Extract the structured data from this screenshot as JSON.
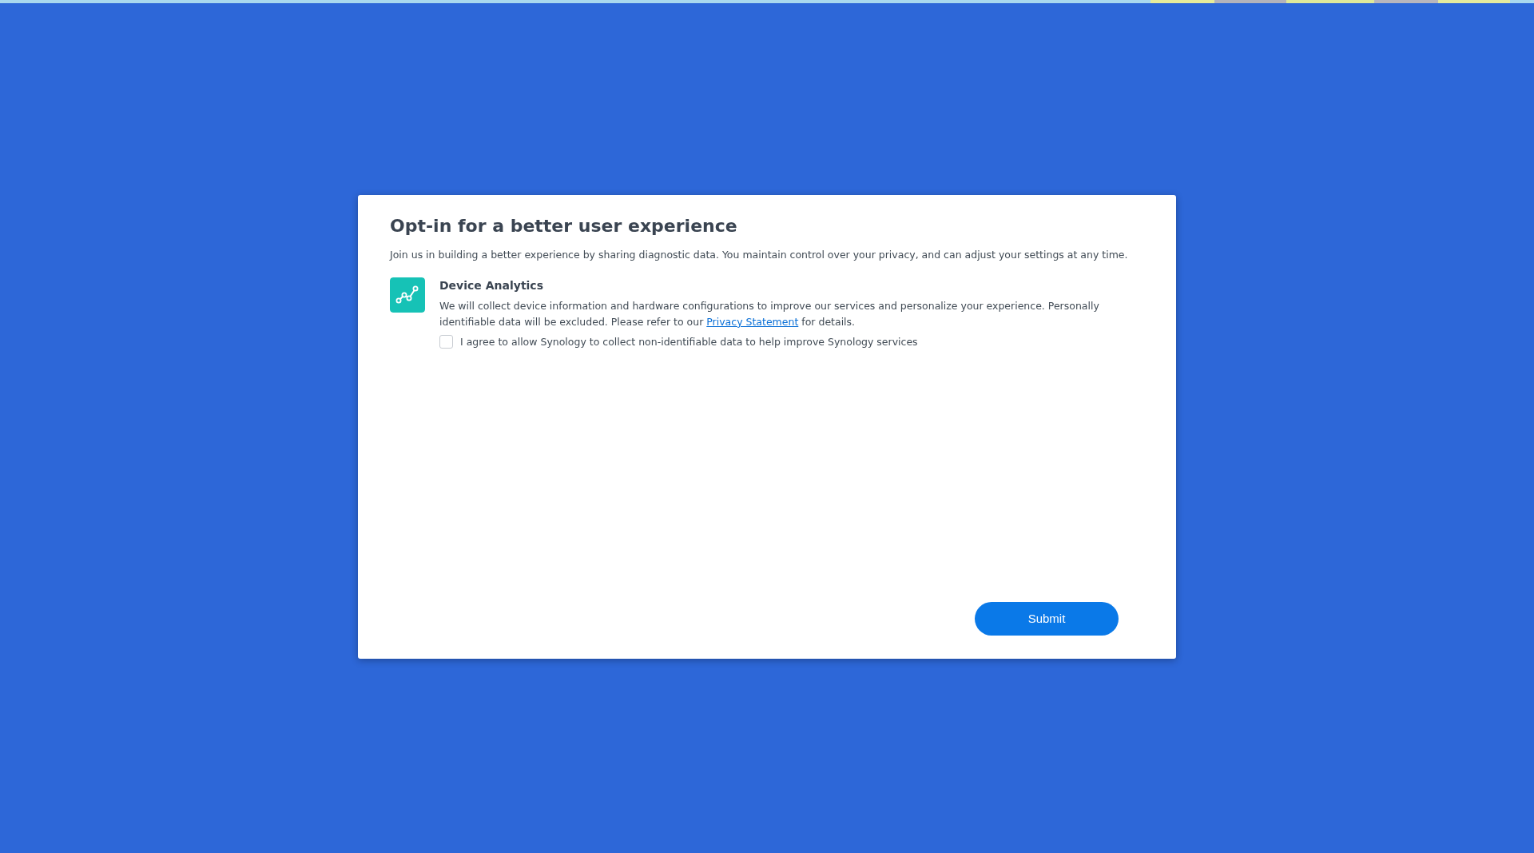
{
  "dialog": {
    "title": "Opt-in for a better user experience",
    "intro": "Join us in building a better experience by sharing diagnostic data. You maintain control over your privacy, and can adjust your settings at any time.",
    "section": {
      "title": "Device Analytics",
      "text_before": "We will collect device information and hardware configurations to improve our services and personalize your experience. Personally identifiable data will be excluded. Please refer to our",
      "link": "Privacy Statement",
      "text_after": "for details."
    },
    "consent": {
      "label": "I agree to allow Synology to collect non-identifiable data to help improve Synology services",
      "checked": false
    },
    "button": "Submit"
  }
}
